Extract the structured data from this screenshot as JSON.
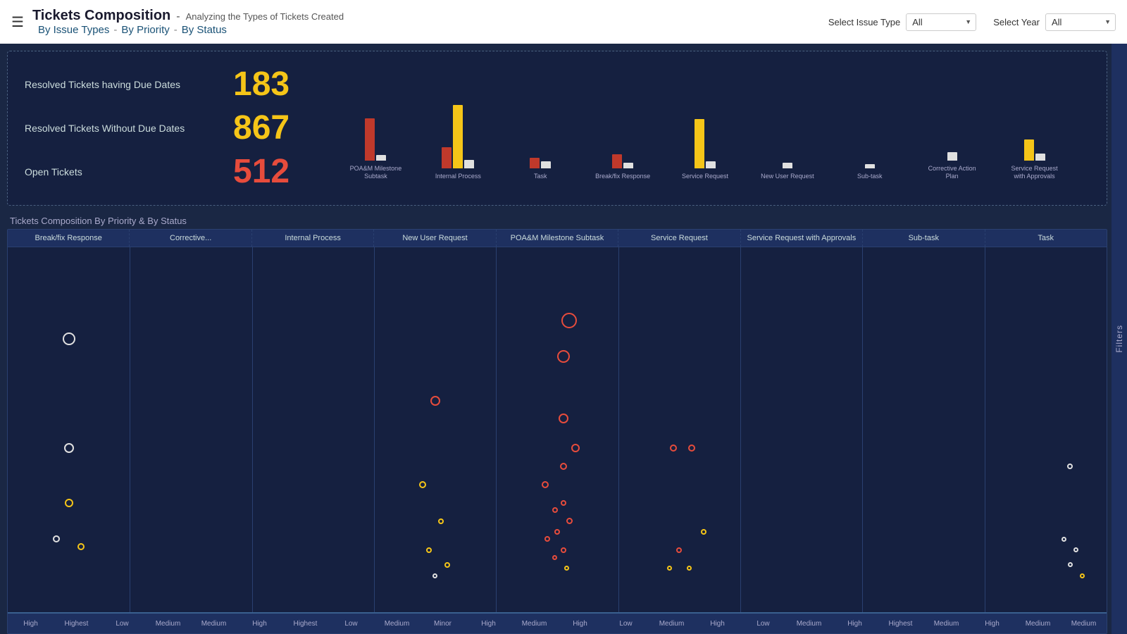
{
  "header": {
    "menu_icon": "☰",
    "title": "Tickets Composition",
    "subtitle": "Analyzing the Types of Tickets Created",
    "nav": {
      "item1": "By Issue Types",
      "sep1": "-",
      "item2": "By Priority",
      "sep2": "-",
      "item3": "By Status"
    },
    "select_issue_type_label": "Select Issue Type",
    "select_year_label": "Select Year",
    "issue_type_value": "All",
    "year_value": "All"
  },
  "filters": {
    "label": "Filters"
  },
  "stats": {
    "resolved_with_label": "Resolved Tickets having Due Dates",
    "resolved_with_value": "183",
    "resolved_without_label": "Resolved Tickets Without Due Dates",
    "resolved_without_value": "867",
    "open_label": "Open Tickets",
    "open_value": "512"
  },
  "bar_chart": {
    "groups": [
      {
        "label": "POA&M Milestone\nSubtask",
        "red": 60,
        "yellow": 0,
        "white": 8
      },
      {
        "label": "Internal Process",
        "red": 30,
        "yellow": 90,
        "white": 12
      },
      {
        "label": "Task",
        "red": 15,
        "yellow": 0,
        "white": 10
      },
      {
        "label": "Break/fix Response",
        "red": 20,
        "yellow": 0,
        "white": 8
      },
      {
        "label": "Service Request",
        "red": 0,
        "yellow": 70,
        "white": 10
      },
      {
        "label": "New User Request",
        "red": 0,
        "yellow": 0,
        "white": 8
      },
      {
        "label": "Sub-task",
        "red": 0,
        "yellow": 0,
        "white": 6
      },
      {
        "label": "Corrective Action Plan",
        "red": 0,
        "yellow": 0,
        "white": 12
      },
      {
        "label": "Service Request\nwith Approvals",
        "red": 0,
        "yellow": 30,
        "white": 10
      }
    ]
  },
  "section_title": "Tickets Composition By Priority & By Status",
  "scatter": {
    "col_headers": [
      "Break/fix Response",
      "Corrective...",
      "Internal Process",
      "New User Request",
      "POA&M Milestone Subtask",
      "Service Request",
      "Service Request with Approvals",
      "Sub-task",
      "Task"
    ],
    "x_labels": [
      "High",
      "Highest",
      "Low",
      "Medium",
      "Medium",
      "High",
      "Highest",
      "Low",
      "Medium",
      "Minor",
      "High",
      "Medium",
      "High",
      "Low",
      "Medium",
      "High",
      "Low",
      "Medium",
      "High",
      "Highest",
      "Medium",
      "High",
      "Medium",
      "Medium"
    ]
  },
  "dots": [
    {
      "col": 1,
      "x_pct": 50,
      "y_pct": 25,
      "size": 18,
      "color": "white"
    },
    {
      "col": 1,
      "x_pct": 50,
      "y_pct": 55,
      "size": 14,
      "color": "white"
    },
    {
      "col": 1,
      "x_pct": 50,
      "y_pct": 70,
      "size": 12,
      "color": "yellow"
    },
    {
      "col": 1,
      "x_pct": 40,
      "y_pct": 80,
      "size": 10,
      "color": "white"
    },
    {
      "col": 1,
      "x_pct": 60,
      "y_pct": 82,
      "size": 10,
      "color": "yellow"
    },
    {
      "col": 4,
      "x_pct": 50,
      "y_pct": 42,
      "size": 14,
      "color": "red"
    },
    {
      "col": 4,
      "x_pct": 40,
      "y_pct": 65,
      "size": 10,
      "color": "yellow"
    },
    {
      "col": 4,
      "x_pct": 55,
      "y_pct": 75,
      "size": 8,
      "color": "yellow"
    },
    {
      "col": 4,
      "x_pct": 45,
      "y_pct": 83,
      "size": 8,
      "color": "yellow"
    },
    {
      "col": 4,
      "x_pct": 60,
      "y_pct": 87,
      "size": 8,
      "color": "yellow"
    },
    {
      "col": 4,
      "x_pct": 50,
      "y_pct": 90,
      "size": 7,
      "color": "white"
    },
    {
      "col": 5,
      "x_pct": 60,
      "y_pct": 20,
      "size": 22,
      "color": "red"
    },
    {
      "col": 5,
      "x_pct": 55,
      "y_pct": 30,
      "size": 18,
      "color": "red"
    },
    {
      "col": 5,
      "x_pct": 55,
      "y_pct": 47,
      "size": 14,
      "color": "red"
    },
    {
      "col": 5,
      "x_pct": 65,
      "y_pct": 55,
      "size": 12,
      "color": "red"
    },
    {
      "col": 5,
      "x_pct": 55,
      "y_pct": 60,
      "size": 10,
      "color": "red"
    },
    {
      "col": 5,
      "x_pct": 40,
      "y_pct": 65,
      "size": 10,
      "color": "red"
    },
    {
      "col": 5,
      "x_pct": 55,
      "y_pct": 70,
      "size": 8,
      "color": "red"
    },
    {
      "col": 5,
      "x_pct": 48,
      "y_pct": 72,
      "size": 8,
      "color": "red"
    },
    {
      "col": 5,
      "x_pct": 60,
      "y_pct": 75,
      "size": 9,
      "color": "red"
    },
    {
      "col": 5,
      "x_pct": 50,
      "y_pct": 78,
      "size": 8,
      "color": "red"
    },
    {
      "col": 5,
      "x_pct": 42,
      "y_pct": 80,
      "size": 8,
      "color": "red"
    },
    {
      "col": 5,
      "x_pct": 55,
      "y_pct": 83,
      "size": 8,
      "color": "red"
    },
    {
      "col": 5,
      "x_pct": 48,
      "y_pct": 85,
      "size": 7,
      "color": "red"
    },
    {
      "col": 5,
      "x_pct": 58,
      "y_pct": 88,
      "size": 7,
      "color": "yellow"
    },
    {
      "col": 6,
      "x_pct": 45,
      "y_pct": 55,
      "size": 10,
      "color": "red"
    },
    {
      "col": 6,
      "x_pct": 60,
      "y_pct": 55,
      "size": 10,
      "color": "red"
    },
    {
      "col": 6,
      "x_pct": 70,
      "y_pct": 78,
      "size": 8,
      "color": "yellow"
    },
    {
      "col": 6,
      "x_pct": 50,
      "y_pct": 83,
      "size": 8,
      "color": "red"
    },
    {
      "col": 6,
      "x_pct": 42,
      "y_pct": 88,
      "size": 7,
      "color": "yellow"
    },
    {
      "col": 6,
      "x_pct": 58,
      "y_pct": 88,
      "size": 7,
      "color": "yellow"
    },
    {
      "col": 9,
      "x_pct": 70,
      "y_pct": 60,
      "size": 8,
      "color": "white"
    },
    {
      "col": 9,
      "x_pct": 65,
      "y_pct": 80,
      "size": 7,
      "color": "white"
    },
    {
      "col": 9,
      "x_pct": 75,
      "y_pct": 83,
      "size": 7,
      "color": "white"
    },
    {
      "col": 9,
      "x_pct": 70,
      "y_pct": 87,
      "size": 7,
      "color": "white"
    },
    {
      "col": 9,
      "x_pct": 80,
      "y_pct": 90,
      "size": 7,
      "color": "yellow"
    }
  ]
}
